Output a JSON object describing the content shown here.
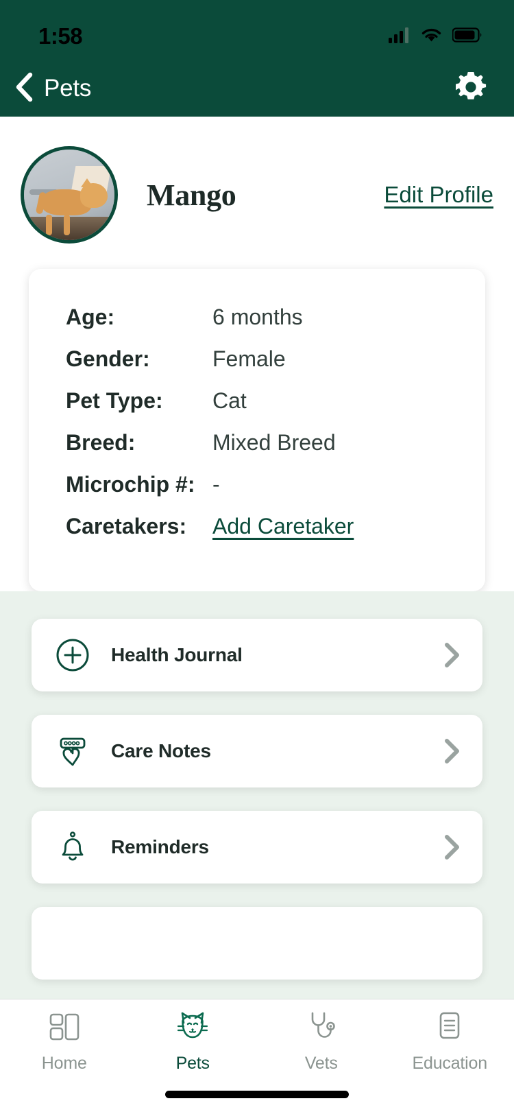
{
  "colors": {
    "brand_green": "#0b4b3a",
    "section_bg": "#eaf2ec",
    "card_white": "#ffffff",
    "muted_gray": "#8b9490",
    "chevron_gray": "#9aa3a0"
  },
  "status_bar": {
    "time": "1:58",
    "signal_icon": "cellular-signal-icon",
    "wifi_icon": "wifi-icon",
    "battery_icon": "battery-icon"
  },
  "navbar": {
    "back_icon": "chevron-left-icon",
    "back_label": "Pets",
    "settings_icon": "gear-icon"
  },
  "profile": {
    "avatar_alt": "Mango the orange cat",
    "name": "Mango",
    "edit_link": "Edit Profile"
  },
  "details": {
    "rows": [
      {
        "label": "Age:",
        "value": "6 months",
        "is_link": false
      },
      {
        "label": "Gender:",
        "value": "Female",
        "is_link": false
      },
      {
        "label": "Pet Type:",
        "value": "Cat",
        "is_link": false
      },
      {
        "label": "Breed:",
        "value": "Mixed Breed",
        "is_link": false
      },
      {
        "label": "Microchip #:",
        "value": "-",
        "is_link": false
      },
      {
        "label": "Caretakers:",
        "value": "Add Caretaker",
        "is_link": true
      }
    ]
  },
  "menu": {
    "items": [
      {
        "label": "Health Journal",
        "icon": "plus-circle-icon",
        "chevron": "chevron-right-icon"
      },
      {
        "label": "Care Notes",
        "icon": "collar-heart-tag-icon",
        "chevron": "chevron-right-icon"
      },
      {
        "label": "Reminders",
        "icon": "bell-icon",
        "chevron": "chevron-right-icon"
      }
    ]
  },
  "tabbar": {
    "tabs": [
      {
        "label": "Home",
        "icon": "dashboard-grid-icon",
        "active": false
      },
      {
        "label": "Pets",
        "icon": "cat-face-icon",
        "active": true
      },
      {
        "label": "Vets",
        "icon": "stethoscope-icon",
        "active": false
      },
      {
        "label": "Education",
        "icon": "document-lines-icon",
        "active": false
      }
    ]
  }
}
